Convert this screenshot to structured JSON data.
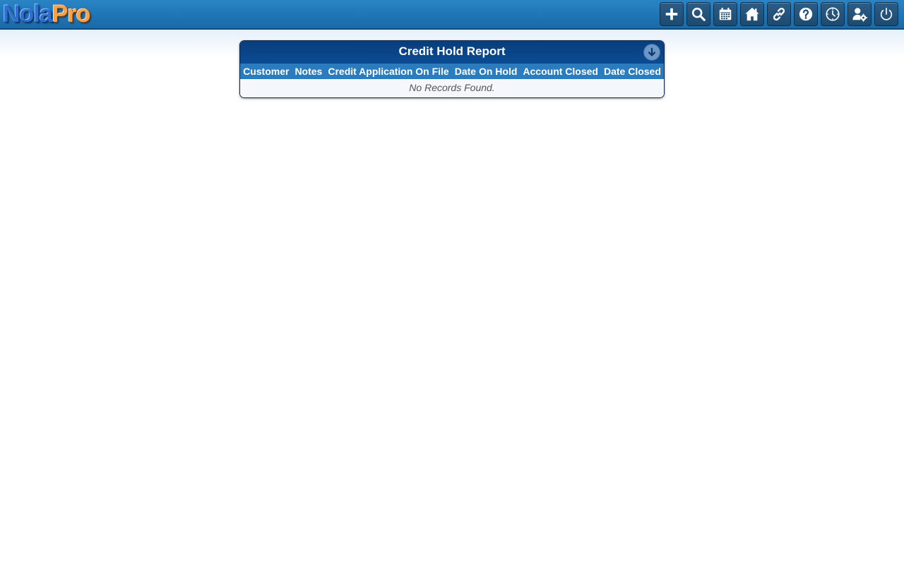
{
  "app": {
    "logo_part1": "Nola",
    "logo_part2": "Pro"
  },
  "toolbar": {
    "items": [
      {
        "name": "add-button",
        "icon": "plus-icon"
      },
      {
        "name": "search-button",
        "icon": "search-icon"
      },
      {
        "name": "calendar-button",
        "icon": "calendar-icon"
      },
      {
        "name": "home-button",
        "icon": "home-icon"
      },
      {
        "name": "links-button",
        "icon": "link-icon"
      },
      {
        "name": "help-button",
        "icon": "question-icon"
      },
      {
        "name": "time-button",
        "icon": "clock-icon"
      },
      {
        "name": "user-settings-button",
        "icon": "user-gear-icon"
      },
      {
        "name": "logout-button",
        "icon": "power-icon"
      }
    ]
  },
  "report": {
    "title": "Credit Hold Report",
    "download_icon": "download-icon",
    "columns": [
      "Customer",
      "Notes",
      "Credit Application On File",
      "Date On Hold",
      "Account Closed",
      "Date Closed"
    ],
    "empty_message": "No Records Found."
  },
  "colors": {
    "topbar": "#1f75b5",
    "panel_title": "#0b4b92",
    "header_row": "#2a7cbf",
    "logo_nola": "#2f6fd0",
    "logo_pro": "#f7a24a"
  }
}
